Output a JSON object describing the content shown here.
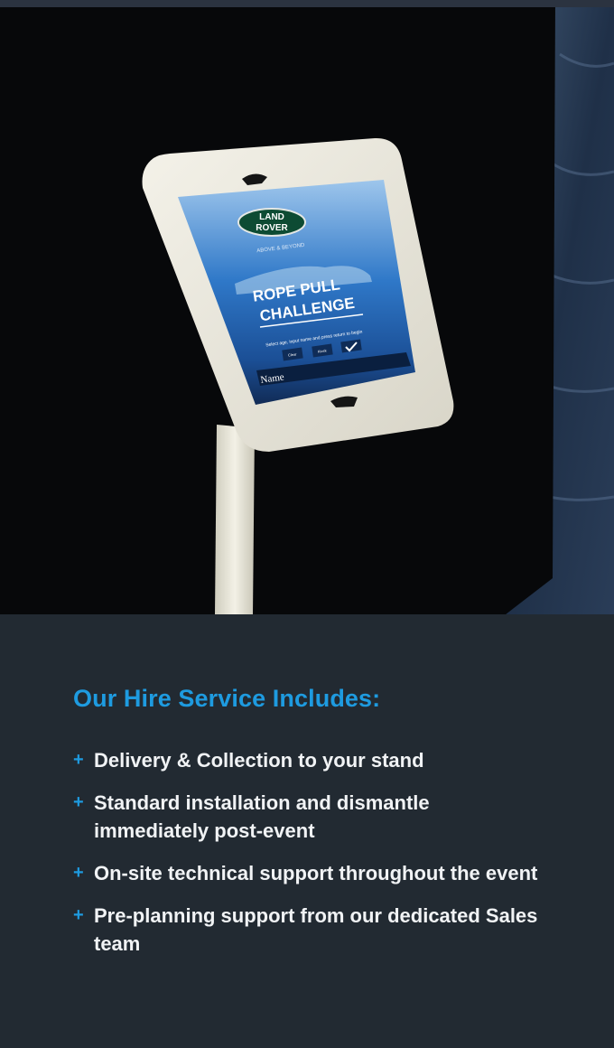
{
  "hero": {
    "alt": "White tablet kiosk stand displaying a Land Rover Rope Pull Challenge app",
    "screen": {
      "logo_line1": "LAND",
      "logo_line2": "ROVER",
      "tagline": "ABOVE & BEYOND",
      "title_line1": "ROPE PULL",
      "title_line2": "CHALLENGE",
      "instructions": "Select age, input name and press return to begin",
      "button_1": "Clear",
      "button_2": "Kiosk",
      "name_label": "Name"
    }
  },
  "services": {
    "heading": "Our Hire Service Includes:",
    "bullet_symbol": "+",
    "items": [
      {
        "text": "Delivery & Collection to your stand"
      },
      {
        "text": "Standard installation and dismantle immediately post-event"
      },
      {
        "text": "On-site technical support throughout the event"
      },
      {
        "text": "Pre-planning support from our dedicated Sales team"
      }
    ]
  },
  "colors": {
    "accent": "#1e9be0",
    "panel_bg": "#222a32",
    "text": "#f1f3f5"
  }
}
